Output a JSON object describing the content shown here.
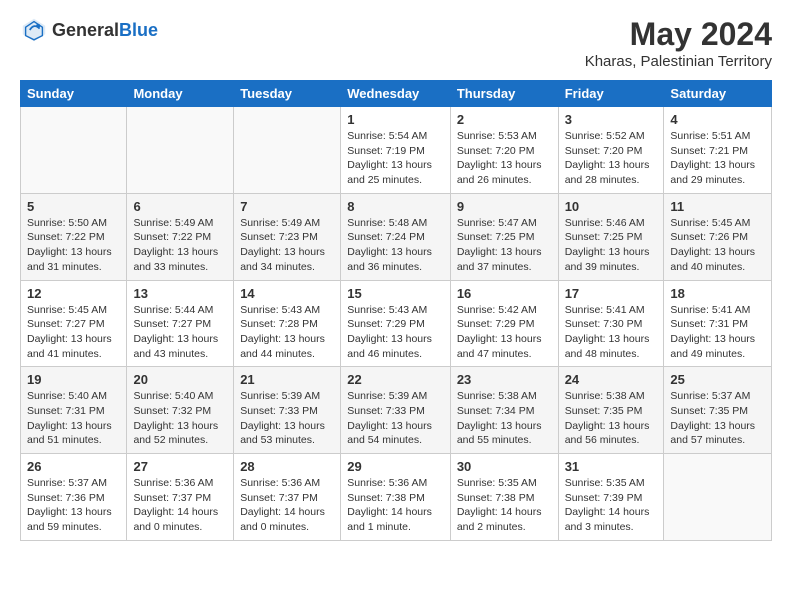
{
  "header": {
    "logo_general": "General",
    "logo_blue": "Blue",
    "title": "May 2024",
    "location": "Kharas, Palestinian Territory"
  },
  "weekdays": [
    "Sunday",
    "Monday",
    "Tuesday",
    "Wednesday",
    "Thursday",
    "Friday",
    "Saturday"
  ],
  "weeks": [
    [
      {
        "day": "",
        "sunrise": "",
        "sunset": "",
        "daylight": ""
      },
      {
        "day": "",
        "sunrise": "",
        "sunset": "",
        "daylight": ""
      },
      {
        "day": "",
        "sunrise": "",
        "sunset": "",
        "daylight": ""
      },
      {
        "day": "1",
        "sunrise": "Sunrise: 5:54 AM",
        "sunset": "Sunset: 7:19 PM",
        "daylight": "Daylight: 13 hours and 25 minutes."
      },
      {
        "day": "2",
        "sunrise": "Sunrise: 5:53 AM",
        "sunset": "Sunset: 7:20 PM",
        "daylight": "Daylight: 13 hours and 26 minutes."
      },
      {
        "day": "3",
        "sunrise": "Sunrise: 5:52 AM",
        "sunset": "Sunset: 7:20 PM",
        "daylight": "Daylight: 13 hours and 28 minutes."
      },
      {
        "day": "4",
        "sunrise": "Sunrise: 5:51 AM",
        "sunset": "Sunset: 7:21 PM",
        "daylight": "Daylight: 13 hours and 29 minutes."
      }
    ],
    [
      {
        "day": "5",
        "sunrise": "Sunrise: 5:50 AM",
        "sunset": "Sunset: 7:22 PM",
        "daylight": "Daylight: 13 hours and 31 minutes."
      },
      {
        "day": "6",
        "sunrise": "Sunrise: 5:49 AM",
        "sunset": "Sunset: 7:22 PM",
        "daylight": "Daylight: 13 hours and 33 minutes."
      },
      {
        "day": "7",
        "sunrise": "Sunrise: 5:49 AM",
        "sunset": "Sunset: 7:23 PM",
        "daylight": "Daylight: 13 hours and 34 minutes."
      },
      {
        "day": "8",
        "sunrise": "Sunrise: 5:48 AM",
        "sunset": "Sunset: 7:24 PM",
        "daylight": "Daylight: 13 hours and 36 minutes."
      },
      {
        "day": "9",
        "sunrise": "Sunrise: 5:47 AM",
        "sunset": "Sunset: 7:25 PM",
        "daylight": "Daylight: 13 hours and 37 minutes."
      },
      {
        "day": "10",
        "sunrise": "Sunrise: 5:46 AM",
        "sunset": "Sunset: 7:25 PM",
        "daylight": "Daylight: 13 hours and 39 minutes."
      },
      {
        "day": "11",
        "sunrise": "Sunrise: 5:45 AM",
        "sunset": "Sunset: 7:26 PM",
        "daylight": "Daylight: 13 hours and 40 minutes."
      }
    ],
    [
      {
        "day": "12",
        "sunrise": "Sunrise: 5:45 AM",
        "sunset": "Sunset: 7:27 PM",
        "daylight": "Daylight: 13 hours and 41 minutes."
      },
      {
        "day": "13",
        "sunrise": "Sunrise: 5:44 AM",
        "sunset": "Sunset: 7:27 PM",
        "daylight": "Daylight: 13 hours and 43 minutes."
      },
      {
        "day": "14",
        "sunrise": "Sunrise: 5:43 AM",
        "sunset": "Sunset: 7:28 PM",
        "daylight": "Daylight: 13 hours and 44 minutes."
      },
      {
        "day": "15",
        "sunrise": "Sunrise: 5:43 AM",
        "sunset": "Sunset: 7:29 PM",
        "daylight": "Daylight: 13 hours and 46 minutes."
      },
      {
        "day": "16",
        "sunrise": "Sunrise: 5:42 AM",
        "sunset": "Sunset: 7:29 PM",
        "daylight": "Daylight: 13 hours and 47 minutes."
      },
      {
        "day": "17",
        "sunrise": "Sunrise: 5:41 AM",
        "sunset": "Sunset: 7:30 PM",
        "daylight": "Daylight: 13 hours and 48 minutes."
      },
      {
        "day": "18",
        "sunrise": "Sunrise: 5:41 AM",
        "sunset": "Sunset: 7:31 PM",
        "daylight": "Daylight: 13 hours and 49 minutes."
      }
    ],
    [
      {
        "day": "19",
        "sunrise": "Sunrise: 5:40 AM",
        "sunset": "Sunset: 7:31 PM",
        "daylight": "Daylight: 13 hours and 51 minutes."
      },
      {
        "day": "20",
        "sunrise": "Sunrise: 5:40 AM",
        "sunset": "Sunset: 7:32 PM",
        "daylight": "Daylight: 13 hours and 52 minutes."
      },
      {
        "day": "21",
        "sunrise": "Sunrise: 5:39 AM",
        "sunset": "Sunset: 7:33 PM",
        "daylight": "Daylight: 13 hours and 53 minutes."
      },
      {
        "day": "22",
        "sunrise": "Sunrise: 5:39 AM",
        "sunset": "Sunset: 7:33 PM",
        "daylight": "Daylight: 13 hours and 54 minutes."
      },
      {
        "day": "23",
        "sunrise": "Sunrise: 5:38 AM",
        "sunset": "Sunset: 7:34 PM",
        "daylight": "Daylight: 13 hours and 55 minutes."
      },
      {
        "day": "24",
        "sunrise": "Sunrise: 5:38 AM",
        "sunset": "Sunset: 7:35 PM",
        "daylight": "Daylight: 13 hours and 56 minutes."
      },
      {
        "day": "25",
        "sunrise": "Sunrise: 5:37 AM",
        "sunset": "Sunset: 7:35 PM",
        "daylight": "Daylight: 13 hours and 57 minutes."
      }
    ],
    [
      {
        "day": "26",
        "sunrise": "Sunrise: 5:37 AM",
        "sunset": "Sunset: 7:36 PM",
        "daylight": "Daylight: 13 hours and 59 minutes."
      },
      {
        "day": "27",
        "sunrise": "Sunrise: 5:36 AM",
        "sunset": "Sunset: 7:37 PM",
        "daylight": "Daylight: 14 hours and 0 minutes."
      },
      {
        "day": "28",
        "sunrise": "Sunrise: 5:36 AM",
        "sunset": "Sunset: 7:37 PM",
        "daylight": "Daylight: 14 hours and 0 minutes."
      },
      {
        "day": "29",
        "sunrise": "Sunrise: 5:36 AM",
        "sunset": "Sunset: 7:38 PM",
        "daylight": "Daylight: 14 hours and 1 minute."
      },
      {
        "day": "30",
        "sunrise": "Sunrise: 5:35 AM",
        "sunset": "Sunset: 7:38 PM",
        "daylight": "Daylight: 14 hours and 2 minutes."
      },
      {
        "day": "31",
        "sunrise": "Sunrise: 5:35 AM",
        "sunset": "Sunset: 7:39 PM",
        "daylight": "Daylight: 14 hours and 3 minutes."
      },
      {
        "day": "",
        "sunrise": "",
        "sunset": "",
        "daylight": ""
      }
    ]
  ]
}
